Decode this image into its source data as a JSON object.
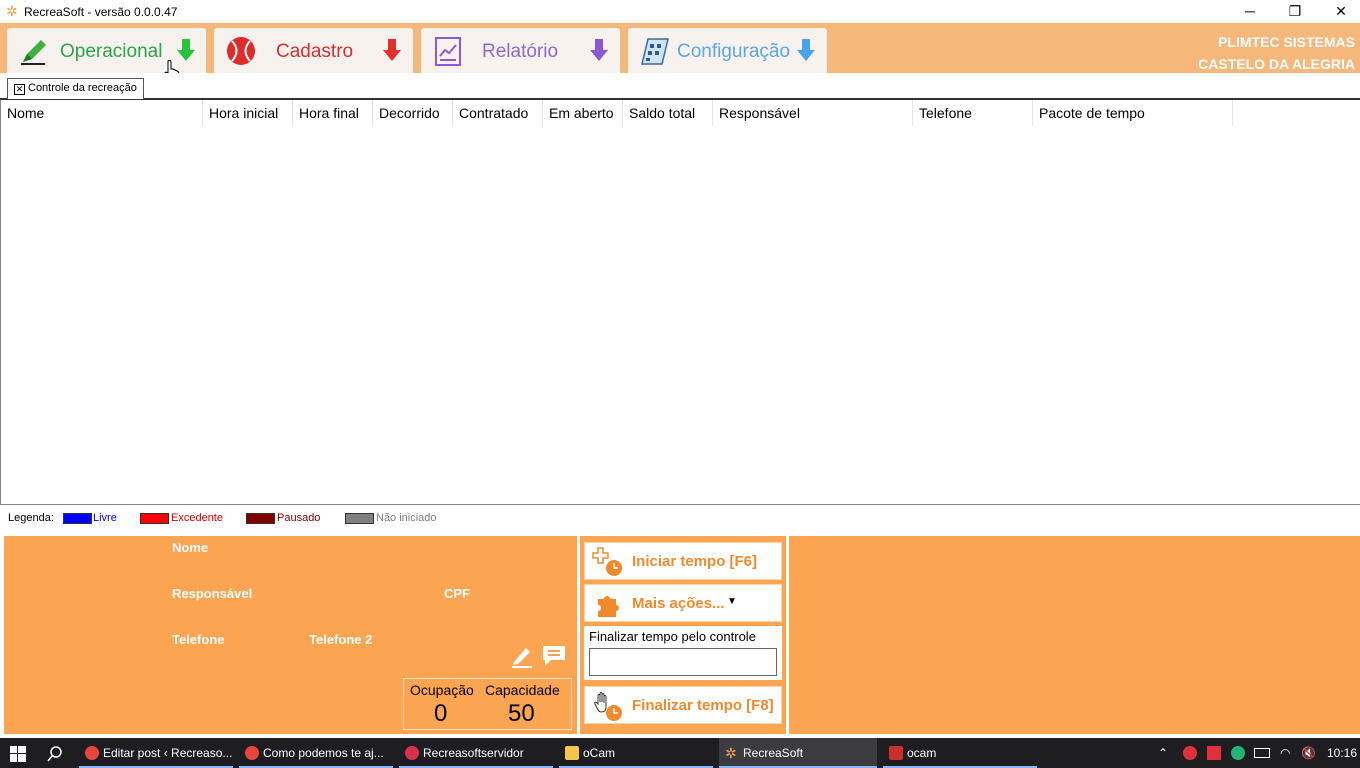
{
  "window": {
    "title": "RecreaSoft  -  versão 0.0.0.47",
    "minimize_label": "─",
    "restore_label": "❐",
    "close_label": "✕"
  },
  "ribbon": {
    "tabs": [
      {
        "label": "Operacional",
        "color": "#2ca44a",
        "arrow_color": "#27c43a"
      },
      {
        "label": "Cadastro",
        "color": "#d42f2f",
        "arrow_color": "#e03030"
      },
      {
        "label": "Relatório",
        "color": "#8a6ad0",
        "arrow_color": "#8a5ad6"
      },
      {
        "label": "Configuração",
        "color": "#5aa6e6",
        "arrow_color": "#4aa2ea"
      }
    ],
    "company_line1": "PLIMTEC SISTEMAS",
    "company_line2": "CASTELO DA ALEGRIA"
  },
  "doc_tab": {
    "close_label": "✕",
    "label": "Controle da recreação"
  },
  "grid": {
    "columns": [
      "Nome",
      "Hora inicial",
      "Hora final",
      "Decorrido",
      "Contratado",
      "Em aberto",
      "Saldo total",
      "Responsável",
      "Telefone",
      "Pacote de tempo"
    ],
    "rows": []
  },
  "legend": {
    "title": "Legenda:",
    "items": [
      {
        "label": "Livre",
        "color": "#0000ff"
      },
      {
        "label": "Excedente",
        "color": "#ff0000"
      },
      {
        "label": "Pausado",
        "color": "#800000"
      },
      {
        "label": "Não iniciado",
        "color": "#808080"
      }
    ]
  },
  "detail": {
    "nome_label": "Nome",
    "responsavel_label": "Responsável",
    "cpf_label": "CPF",
    "telefone_label": "Telefone",
    "telefone2_label": "Telefone 2",
    "ocupacao_label": "Ocupação",
    "capacidade_label": "Capacidade",
    "ocupacao_value": "0",
    "capacidade_value": "50"
  },
  "actions": {
    "iniciar": "Iniciar tempo [F6]",
    "mais": "Mais ações...",
    "finalizar_controle_label": "Finalizar tempo pelo controle",
    "finalizar_controle_value": "",
    "finalizar": "Finalizar tempo [F8]"
  },
  "taskbar": {
    "items": [
      {
        "label": "Editar post ‹ Recreaso...",
        "icon": "chrome-icon"
      },
      {
        "label": "Como podemos te aj...",
        "icon": "chrome-icon"
      },
      {
        "label": "Recreasoftservidor",
        "icon": "dx-icon"
      },
      {
        "label": "oCam",
        "icon": "folder-icon"
      },
      {
        "label": "RecreaSoft",
        "icon": "recreasoft-icon"
      },
      {
        "label": "ocam",
        "icon": "ocam-icon"
      }
    ],
    "clock": "10:16"
  }
}
